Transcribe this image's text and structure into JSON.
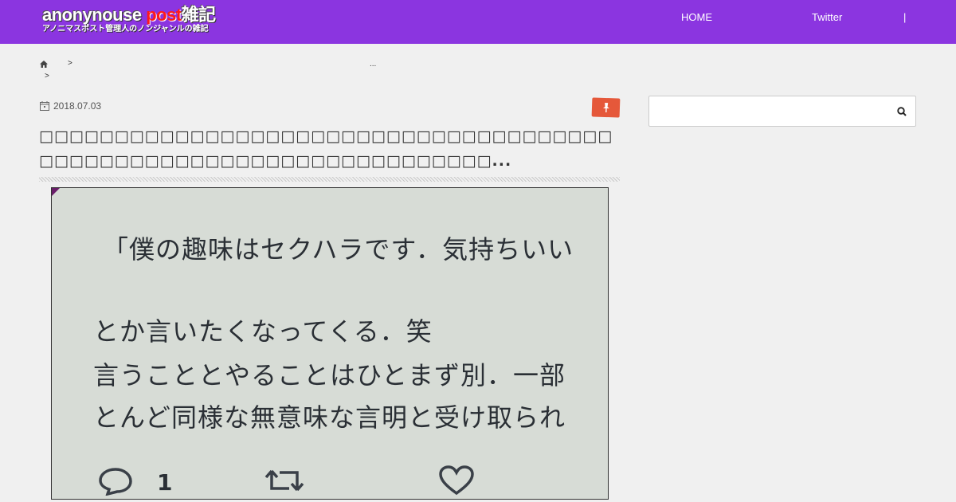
{
  "header": {
    "logo_main": "anonynouse",
    "logo_accent": "post",
    "logo_suffix": "雑記",
    "logo_sub": "アノニマスポスト管理人のノンジャンルの雑記",
    "nav": [
      "HOME",
      "Twitter",
      "|"
    ]
  },
  "breadcrumb": {
    "sep1": ">",
    "ellipsis": "...",
    "sep2": ">"
  },
  "article": {
    "date": "2018.07.03",
    "title": "□□□□□□□□□□□□□□□□□□□□□□□□□□□□□□□□□□□□□□□□□□□□□□□□□□□□□□□□□□□□□□□□□□□□...",
    "photo_lines": [
      "「僕の趣味はセクハラです．気持ちいい",
      "とか言いたくなってくる．笑",
      "言うこととやることはひとまず別．一部",
      "とんど同様な無意味な言明と受け取られ"
    ],
    "reply_count": "1"
  },
  "colors": {
    "header_bg": "#8b35e0",
    "category_badge": "#e5583a",
    "logo_accent": "#ff1a1a"
  },
  "icons": {
    "home": "home-icon",
    "date": "calendar-icon",
    "category": "pin-icon",
    "search": "search-icon",
    "reply": "reply-icon",
    "retweet": "retweet-icon",
    "like": "heart-icon"
  }
}
